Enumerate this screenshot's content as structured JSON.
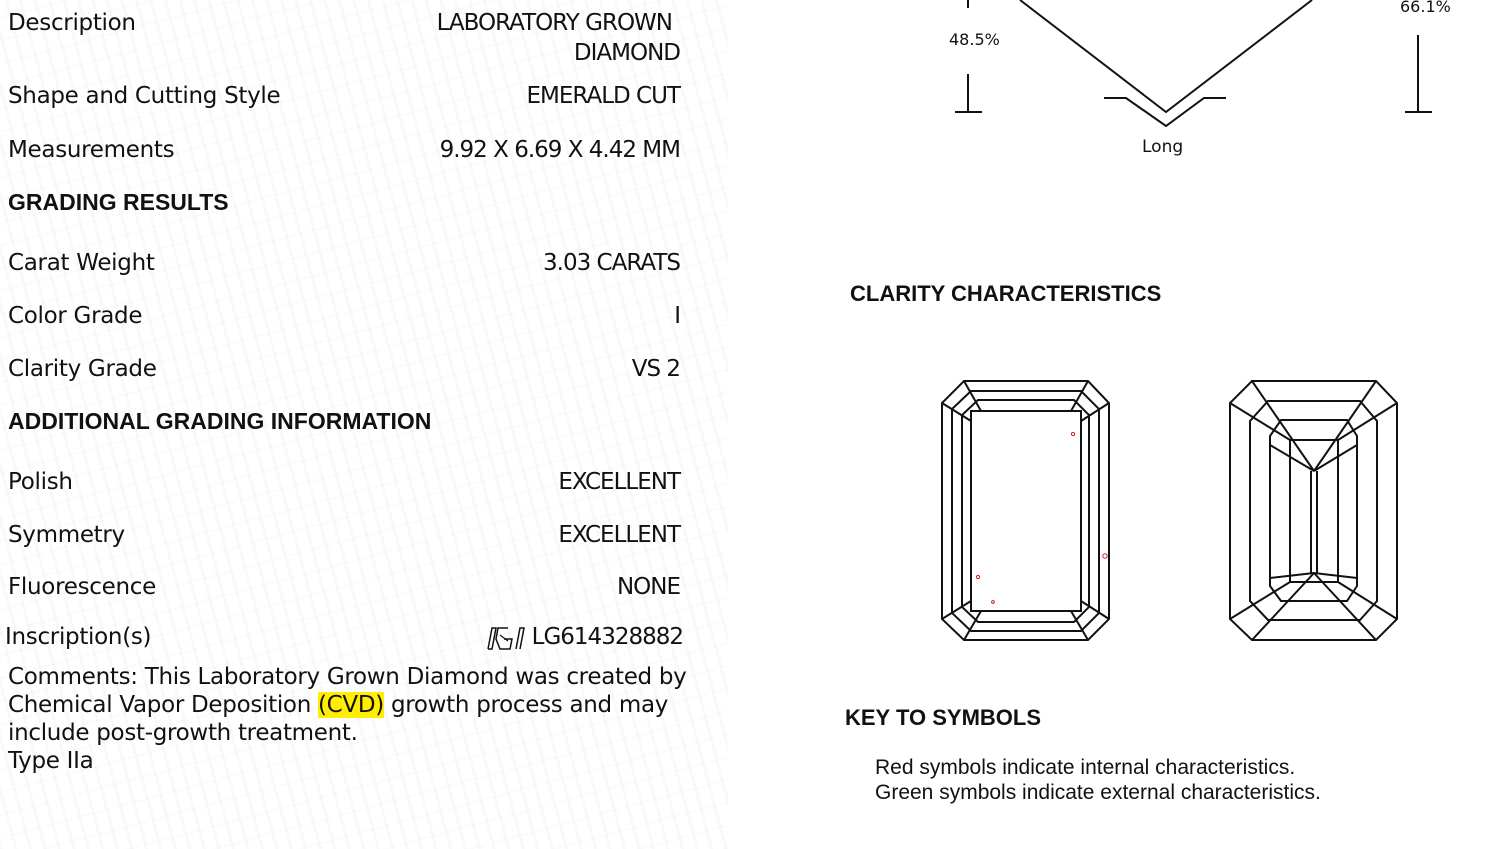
{
  "details": [
    {
      "label": "Description",
      "value_line1": "LABORATORY GROWN",
      "value_line2": "DIAMOND"
    },
    {
      "label": "Shape and Cutting Style",
      "value": "EMERALD CUT"
    },
    {
      "label": "Measurements",
      "value": "9.92 X 6.69 X 4.42 MM"
    }
  ],
  "grading_results": {
    "heading": "GRADING RESULTS",
    "rows": [
      {
        "label": "Carat Weight",
        "value": "3.03 CARATS"
      },
      {
        "label": "Color Grade",
        "value": "I"
      },
      {
        "label": "Clarity Grade",
        "value": "VS 2"
      }
    ]
  },
  "additional": {
    "heading": "ADDITIONAL GRADING INFORMATION",
    "rows": [
      {
        "label": "Polish",
        "value": "EXCELLENT"
      },
      {
        "label": "Symmetry",
        "value": "EXCELLENT"
      },
      {
        "label": "Fluorescence",
        "value": "NONE"
      },
      {
        "label": "Inscription(s)",
        "value": "LG614328882",
        "icon": "igi-logo-icon"
      }
    ]
  },
  "comments": {
    "prefix": "Comments: This Laboratory Grown Diamond was created by Chemical Vapor Deposition ",
    "highlight": "(CVD)",
    "suffix": " growth process and may include post-growth treatment.",
    "type_line": "Type IIa",
    "highlight_color": "#ffee00"
  },
  "proportions": {
    "left_percent": "48.5%",
    "right_percent": "66.1%",
    "view_label": "Long"
  },
  "clarity": {
    "heading": "CLARITY CHARACTERISTICS",
    "inclusion_color": "#cc2222"
  },
  "key_to_symbols": {
    "heading": "KEY TO SYMBOLS",
    "line1": "Red symbols indicate internal characteristics.",
    "line2": "Green symbols indicate external characteristics."
  }
}
